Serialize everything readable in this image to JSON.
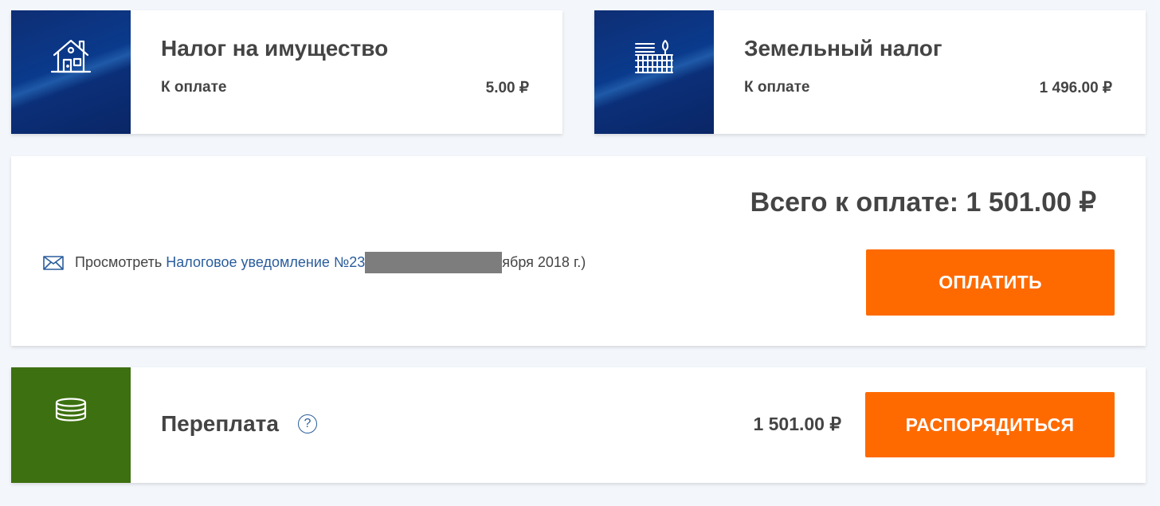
{
  "property_tax": {
    "title": "Налог на имущество",
    "due_label": "К оплате",
    "amount": "5.00 ₽",
    "icon": "house-icon"
  },
  "land_tax": {
    "title": "Земельный налог",
    "due_label": "К оплате",
    "amount": "1 496.00 ₽",
    "icon": "fence-tree-icon"
  },
  "summary": {
    "total_text": "Всего к оплате: 1 501.00  ₽",
    "notice_prefix": "Просмотреть",
    "notice_link": "Налоговое уведомление №23",
    "notice_suffix": "ября 2018 г.)",
    "pay_button": "ОПЛАТИТЬ"
  },
  "overpayment": {
    "title": "Переплата",
    "help": "?",
    "amount": "1 501.00  ₽",
    "button": "РАСПОРЯДИТЬСЯ",
    "icon": "coins-stack-icon"
  },
  "colors": {
    "accent": "#ff6a00",
    "tile_blue": "#0e2e74",
    "tile_green": "#3d7010",
    "link": "#2a5d9c",
    "text": "#444444",
    "background": "#f3f6fa"
  }
}
